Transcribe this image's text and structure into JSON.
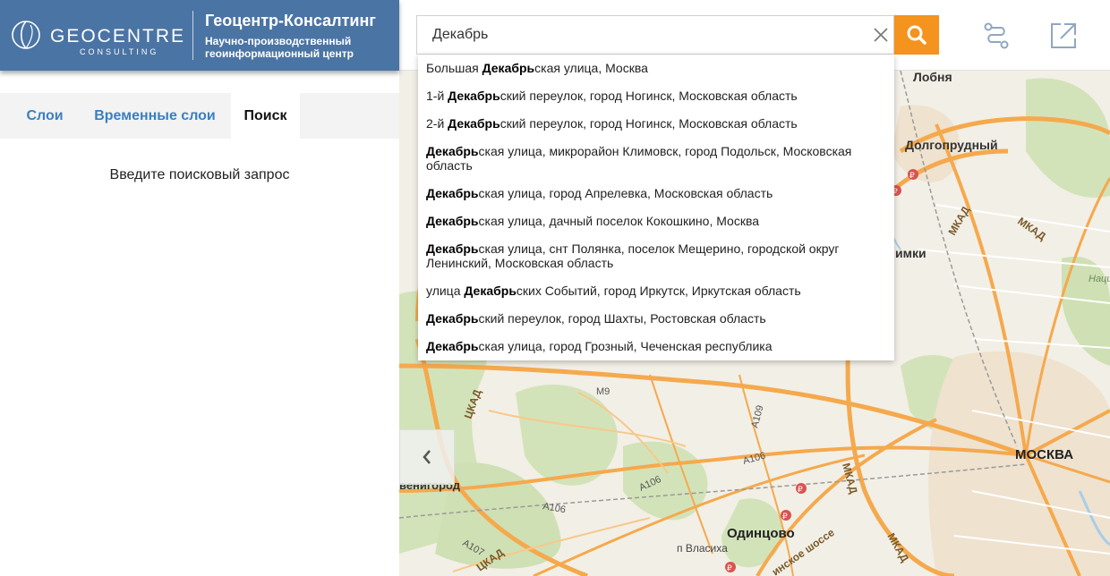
{
  "brand": {
    "wordmark": "GEOCENTRE",
    "wordmark_sub": "CONSULTING",
    "title": "Геоцентр-Консалтинг",
    "desc_line1": "Научно-производственный",
    "desc_line2": "геоинформационный центр",
    "color": "#4a74a4"
  },
  "search": {
    "value": "Декабрь",
    "button_color": "#f4931e"
  },
  "tabs": [
    {
      "label": "Слои",
      "active": false
    },
    {
      "label": "Временные слои",
      "active": false
    },
    {
      "label": "Поиск",
      "active": true
    }
  ],
  "panel": {
    "placeholder": "Введите поисковый запрос"
  },
  "suggestions": [
    {
      "pre": "Большая ",
      "match": "Декабрь",
      "post": "ская улица, Москва"
    },
    {
      "pre": "1-й ",
      "match": "Декабрь",
      "post": "ский переулок, город Ногинск, Московская область"
    },
    {
      "pre": "2-й ",
      "match": "Декабрь",
      "post": "ский переулок, город Ногинск, Московская область"
    },
    {
      "pre": "",
      "match": "Декабрь",
      "post": "ская улица, микрорайон Климовск, город Подольск, Московская область"
    },
    {
      "pre": "",
      "match": "Декабрь",
      "post": "ская улица, город Апрелевка, Московская область"
    },
    {
      "pre": "",
      "match": "Декабрь",
      "post": "ская улица, дачный поселок Кокошкино, Москва"
    },
    {
      "pre": "",
      "match": "Декабрь",
      "post": "ская улица, снт Полянка, поселок Мещерино, городской округ Ленинский, Московская область"
    },
    {
      "pre": "улица ",
      "match": "Декабрь",
      "post": "ских Событий, город Иркутск, Иркутская область"
    },
    {
      "pre": "",
      "match": "Декабрь",
      "post": "ский переулок, город Шахты, Ростовская область"
    },
    {
      "pre": "",
      "match": "Декабрь",
      "post": "ская улица, город Грозный, Чеченская республика"
    }
  ],
  "map": {
    "labels": {
      "lobnya": "Лобня",
      "dolgoprudny": "Долгопрудный",
      "khimki": "имки",
      "moskva": "МОСКВА",
      "odintsovo": "Одинцово",
      "vlasikha": "п Власиха",
      "zvenigorod": "венигород",
      "park": "Национ парк Лосины",
      "mkad": "МКАД",
      "tskad": "ЦКАД",
      "m9": "М9",
      "a106": "А106",
      "a107": "А107",
      "a109": "А109",
      "shosse": "инское шоссе",
      "ruble": "₽"
    },
    "colors": {
      "base": "#f2efe6",
      "forest": "#cfe0b4",
      "road": "#f5a94d",
      "water": "#a9cde8"
    }
  }
}
